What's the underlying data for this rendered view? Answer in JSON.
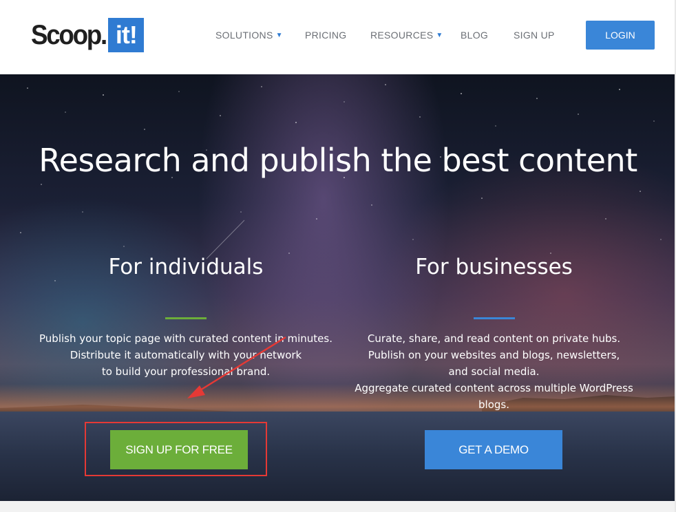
{
  "header": {
    "logo": {
      "text_main": "Scoop.",
      "text_box": "it!"
    },
    "nav": [
      {
        "label": "SOLUTIONS",
        "dropdown": true
      },
      {
        "label": "PRICING",
        "dropdown": false
      },
      {
        "label": "RESOURCES",
        "dropdown": true
      },
      {
        "label": "BLOG",
        "dropdown": false
      },
      {
        "label": "SIGN UP",
        "dropdown": false
      }
    ],
    "caret": "▼",
    "login_label": "LOGIN"
  },
  "hero": {
    "title": "Research and publish the best content",
    "individuals": {
      "title": "For individuals",
      "lines": [
        "Publish your topic page with curated content in minutes.",
        "Distribute it automatically with your network",
        "to build your professional brand."
      ],
      "button_label": "SIGN UP FOR FREE"
    },
    "businesses": {
      "title": "For businesses",
      "lines": [
        "Curate, share, and read content on private hubs.",
        "Publish on your websites and blogs, newsletters,",
        "and social media.",
        "Aggregate curated content across multiple WordPress",
        "blogs."
      ],
      "button_label": "GET A DEMO"
    }
  },
  "colors": {
    "brand_blue": "#3a86d8",
    "accent_green": "#6cae3a",
    "annotation_red": "#e53935"
  }
}
